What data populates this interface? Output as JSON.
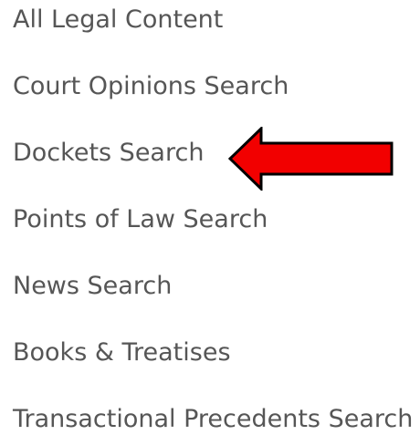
{
  "menu": {
    "items": [
      {
        "label": "All Legal Content"
      },
      {
        "label": "Court Opinions Search"
      },
      {
        "label": "Dockets Search"
      },
      {
        "label": "Points of Law Search"
      },
      {
        "label": "News Search"
      },
      {
        "label": "Books & Treatises"
      },
      {
        "label": "Transactional Precedents Search"
      }
    ]
  },
  "annotation": {
    "arrow_color": "#f20000",
    "arrow_outline": "#000000",
    "points_to": "Dockets Search"
  }
}
